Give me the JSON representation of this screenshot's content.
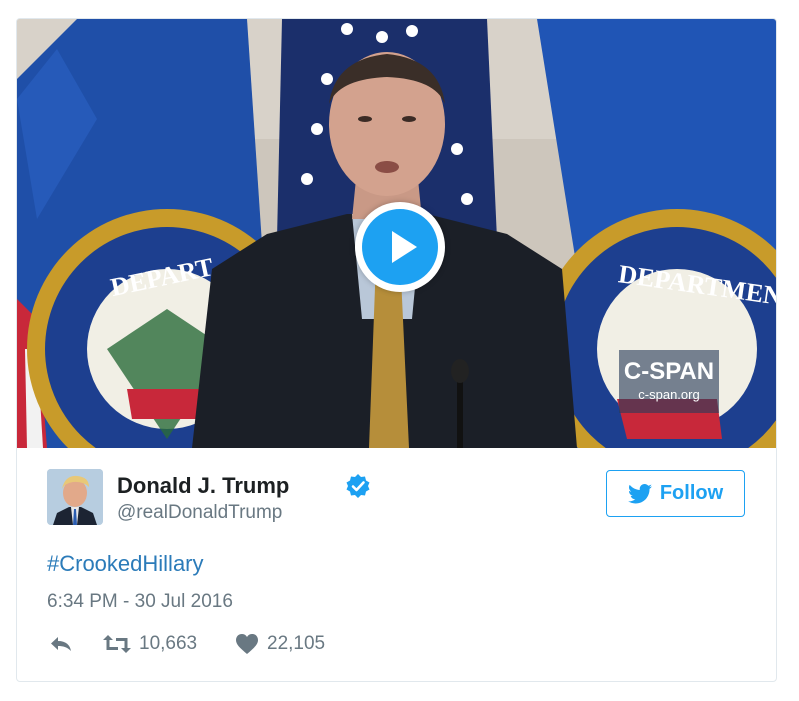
{
  "media": {
    "watermark_title": "C-SPAN",
    "watermark_url": "c-span.org",
    "play_icon": "play-icon"
  },
  "author": {
    "name": "Donald J. Trump",
    "handle": "@realDonaldTrump",
    "verified": true
  },
  "follow": {
    "label": "Follow",
    "icon": "twitter-bird-icon"
  },
  "tweet": {
    "text": "#CrookedHillary",
    "timestamp": "6:34 PM - 30 Jul 2016"
  },
  "actions": {
    "reply_icon": "reply-icon",
    "retweet_icon": "retweet-icon",
    "retweet_count": "10,663",
    "like_icon": "heart-icon",
    "like_count": "22,105"
  },
  "colors": {
    "accent": "#1da1f2",
    "link": "#2b7bb9",
    "muted": "#697882",
    "border": "#e1e8ed"
  }
}
